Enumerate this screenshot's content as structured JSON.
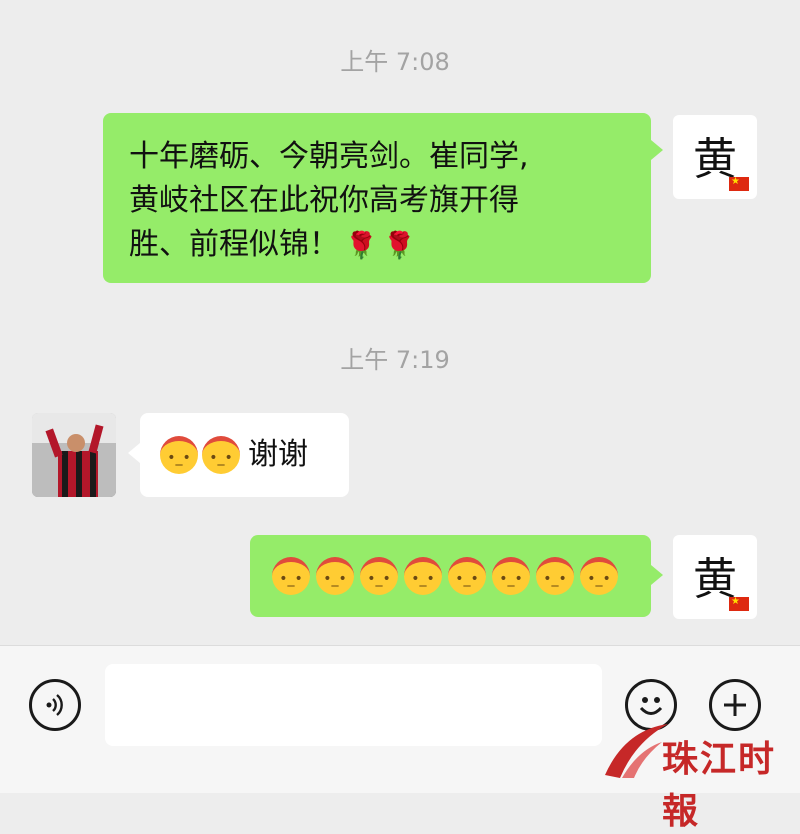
{
  "chat": {
    "timestamps": [
      "上午 7:08",
      "上午 7:19"
    ],
    "messages": [
      {
        "side": "self",
        "avatar_text": "黄",
        "text": "十年磨砺、今朝亮剑。崔同学,\n黄岐社区在此祝你高考旗开得\n胜、前程似锦！",
        "trailing_icons": [
          "rose-icon",
          "rose-icon"
        ]
      },
      {
        "side": "other",
        "emoji_icons": [
          "salute-emoji",
          "salute-emoji"
        ],
        "text": "谢谢"
      },
      {
        "side": "self",
        "avatar_text": "黄",
        "emoji_icons": [
          "salute-emoji",
          "salute-emoji",
          "salute-emoji",
          "salute-emoji",
          "salute-emoji",
          "salute-emoji",
          "salute-emoji",
          "salute-emoji"
        ]
      }
    ]
  },
  "bottom_bar": {
    "voice_icon": "voice-icon",
    "emoji_icon": "smiley-icon",
    "plus_icon": "plus-icon"
  },
  "watermark": {
    "text": "珠江时報"
  },
  "colors": {
    "background": "#ededed",
    "self_bubble": "#95ec69",
    "other_bubble": "#ffffff",
    "timestamp": "#a3a3a3"
  }
}
